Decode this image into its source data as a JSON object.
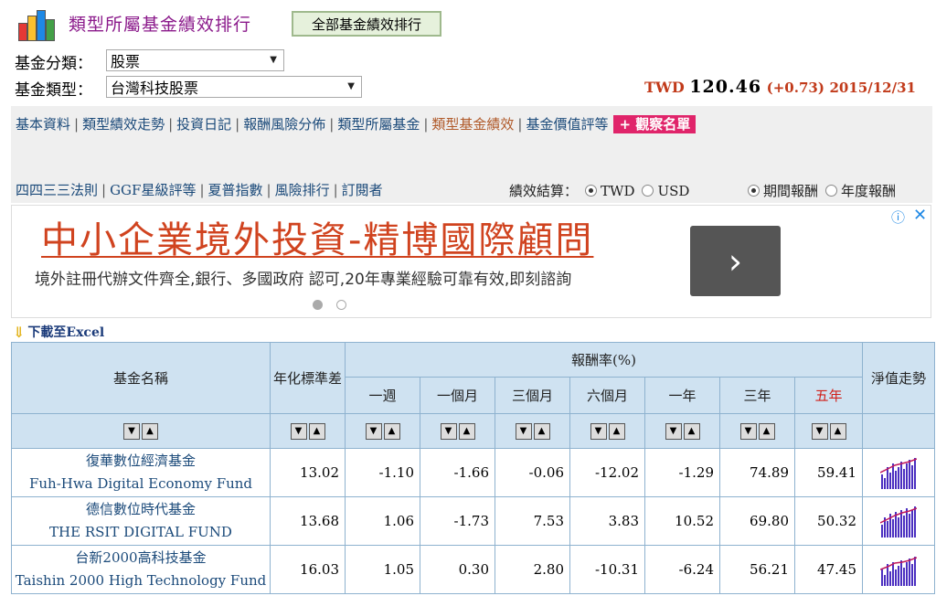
{
  "header": {
    "title": "類型所屬基金績效排行",
    "all_button": "全部基金績效排行",
    "category_label": "基金分類：",
    "category_value": "股票",
    "type_label": "基金類型：",
    "type_value": "台灣科技股票",
    "currency": "TWD",
    "index_value": "120.46",
    "change": "(+0.73)",
    "date": "2015/12/31"
  },
  "nav": {
    "row1": [
      "基本資料",
      "類型績效走勢",
      "投資日記",
      "報酬風險分佈",
      "類型所屬基金",
      "類型基金績效",
      "基金價值評等"
    ],
    "watchlist": "+ 觀察名單",
    "row2": [
      "四四三三法則",
      "GGF星級評等",
      "夏普指數",
      "風險排行",
      "訂閱者"
    ],
    "perf_settle_label": "績效結算：",
    "radio_currency": [
      "TWD",
      "USD"
    ],
    "radio_period": [
      "期間報酬",
      "年度報酬"
    ]
  },
  "ad": {
    "title": "中小企業境外投資-精博國際顧問",
    "desc": "境外註冊代辦文件齊全,銀行、多國政府 認可,20年專業經驗可靠有效,即刻諮詢",
    "button": "›",
    "info": "ⓘ",
    "close": "✕"
  },
  "download_label": "下載至Excel",
  "table": {
    "col_name": "基金名稱",
    "col_std": "年化標準差",
    "col_return": "報酬率(%)",
    "col_nav": "淨值走勢",
    "periods": [
      "一週",
      "一個月",
      "三個月",
      "六個月",
      "一年",
      "三年",
      "五年"
    ],
    "rows": [
      {
        "zh": "復華數位經濟基金",
        "en": "Fuh-Hwa Digital Economy Fund",
        "std": "13.02",
        "vals": [
          "-1.10",
          "-1.66",
          "-0.06",
          "-12.02",
          "-1.29",
          "74.89",
          "59.41"
        ]
      },
      {
        "zh": "德信數位時代基金",
        "en": "THE RSIT DIGITAL FUND",
        "std": "13.68",
        "vals": [
          "1.06",
          "-1.73",
          "7.53",
          "3.83",
          "10.52",
          "69.80",
          "50.32"
        ]
      },
      {
        "zh": "台新2000高科技基金",
        "en": "Taishin 2000 High Technology Fund",
        "std": "16.03",
        "vals": [
          "1.05",
          "0.30",
          "2.80",
          "-10.31",
          "-6.24",
          "56.21",
          "47.45"
        ]
      }
    ]
  },
  "colors": {
    "title": "#8b1a8b",
    "link": "#1b4a7a",
    "header_bg": "#cfe2f1",
    "accent_red": "#c13a1a",
    "watch_bg": "#e0246a"
  }
}
